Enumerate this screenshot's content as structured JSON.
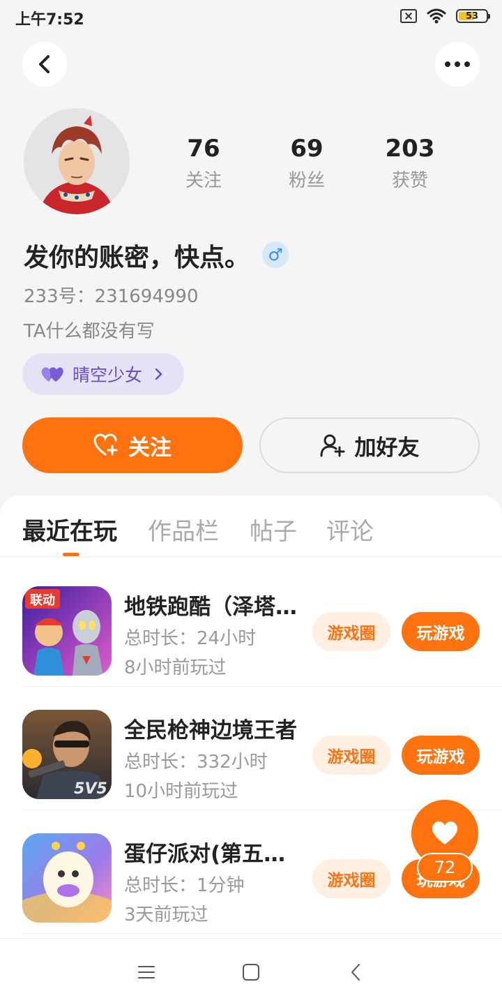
{
  "status_bar": {
    "time": "上午7:52",
    "battery": "53"
  },
  "profile": {
    "stats": [
      {
        "value": "76",
        "label": "关注"
      },
      {
        "value": "69",
        "label": "粉丝"
      },
      {
        "value": "203",
        "label": "获赞"
      }
    ],
    "nickname": "发你的账密，快点。",
    "gender": "♂",
    "user_id": "233号：231694990",
    "bio": "TA什么都没有写",
    "tag": "晴空少女"
  },
  "actions": {
    "follow_label": "关注",
    "add_friend_label": "加好友"
  },
  "tabs": [
    {
      "label": "最近在玩",
      "active": true
    },
    {
      "label": "作品栏",
      "active": false
    },
    {
      "label": "帖子",
      "active": false
    },
    {
      "label": "评论",
      "active": false
    }
  ],
  "games": [
    {
      "title": "地铁跑酷（泽塔…",
      "duration": "总时长：24小时",
      "last_played": "8小时前玩过",
      "circle_label": "游戏圈",
      "play_label": "玩游戏",
      "icon_text": "联动"
    },
    {
      "title": "全民枪神边境王者",
      "duration": "总时长：332小时",
      "last_played": "10小时前玩过",
      "circle_label": "游戏圈",
      "play_label": "玩游戏",
      "icon_text": "5V5"
    },
    {
      "title": "蛋仔派对(第五…",
      "duration": "总时长：1分钟",
      "last_played": "3天前玩过",
      "circle_label": "游戏圈",
      "play_label": "玩游戏",
      "icon_text": ""
    }
  ],
  "floating_like": {
    "count": "72"
  },
  "colors": {
    "accent": "#ff7210",
    "tag_bg": "#e6e2f6",
    "tag_text": "#6a4cc7"
  }
}
